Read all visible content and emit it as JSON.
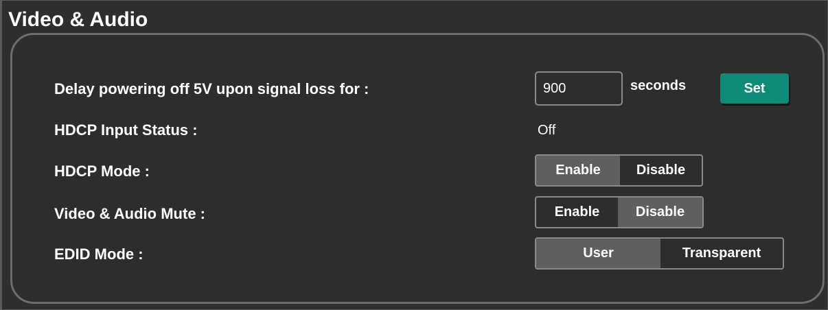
{
  "section": {
    "title": "Video & Audio"
  },
  "power_delay": {
    "label": "Delay powering off 5V upon signal loss for :",
    "value": "900",
    "unit": "seconds",
    "set_label": "Set"
  },
  "hdcp_status": {
    "label": "HDCP Input Status :",
    "value": "Off"
  },
  "hdcp_mode": {
    "label": "HDCP Mode :",
    "options": [
      "Enable",
      "Disable"
    ],
    "selected": "Enable"
  },
  "av_mute": {
    "label": "Video & Audio Mute :",
    "options": [
      "Enable",
      "Disable"
    ],
    "selected": "Disable"
  },
  "edid_mode": {
    "label": "EDID Mode :",
    "options": [
      "User",
      "Transparent"
    ],
    "selected": "User"
  },
  "colors": {
    "background": "#2e2e2e",
    "panel_border": "#6c6c6c",
    "set_button": "#0d8a78",
    "selected_segment": "#5f5f5f",
    "text": "#ffffff"
  }
}
